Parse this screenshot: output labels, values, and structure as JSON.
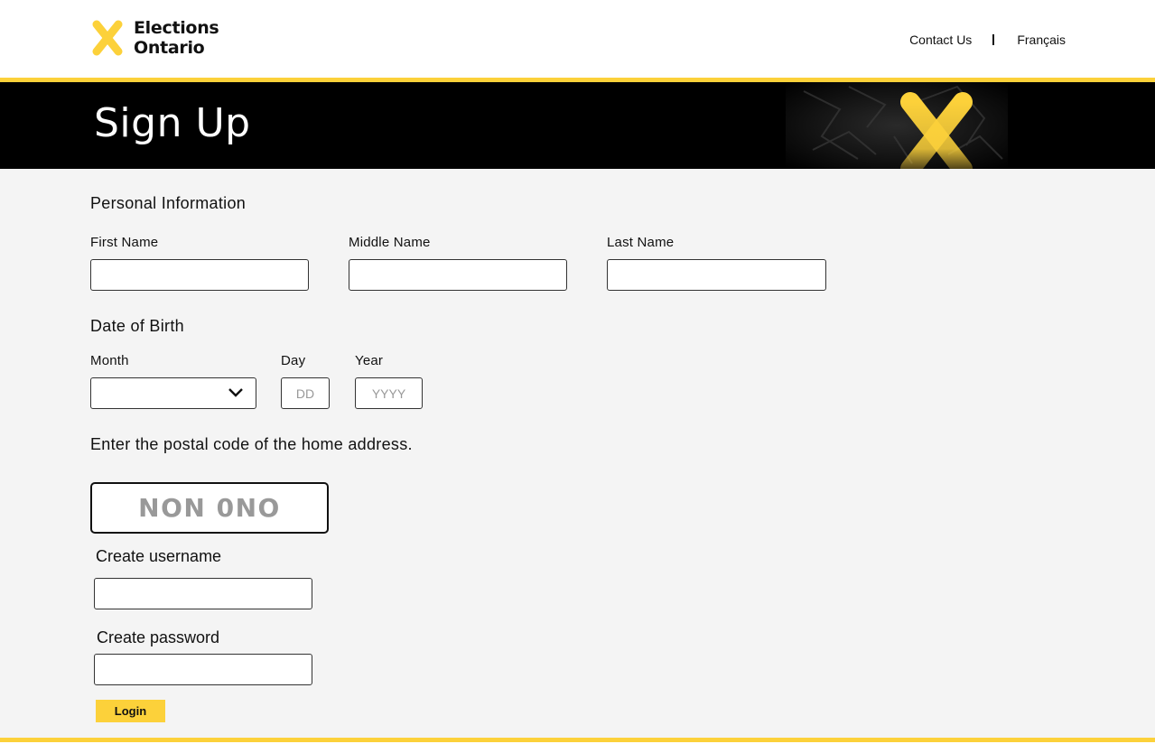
{
  "header": {
    "logo_line1": "Elections",
    "logo_line2": "Ontario",
    "nav": {
      "contact": "Contact Us",
      "french": "Français"
    }
  },
  "hero": {
    "title": "Sign Up"
  },
  "form": {
    "personal_heading": "Personal Information",
    "first_name_label": "First Name",
    "middle_name_label": "Middle Name",
    "last_name_label": "Last Name",
    "first_name_value": "",
    "middle_name_value": "",
    "last_name_value": "",
    "dob_heading": "Date of Birth",
    "month_label": "Month",
    "month_value": "",
    "day_label": "Day",
    "day_placeholder": "DD",
    "year_label": "Year",
    "year_placeholder": "YYYY",
    "postal_prompt": "Enter the postal code of the home address.",
    "postal_placeholder": "NON 0NO",
    "username_label": "Create username",
    "password_label": "Create password",
    "login_label": "Login"
  },
  "colors": {
    "accent": "#fcd13a",
    "hero_bg": "#000000",
    "form_bg": "#f4f4f4"
  }
}
